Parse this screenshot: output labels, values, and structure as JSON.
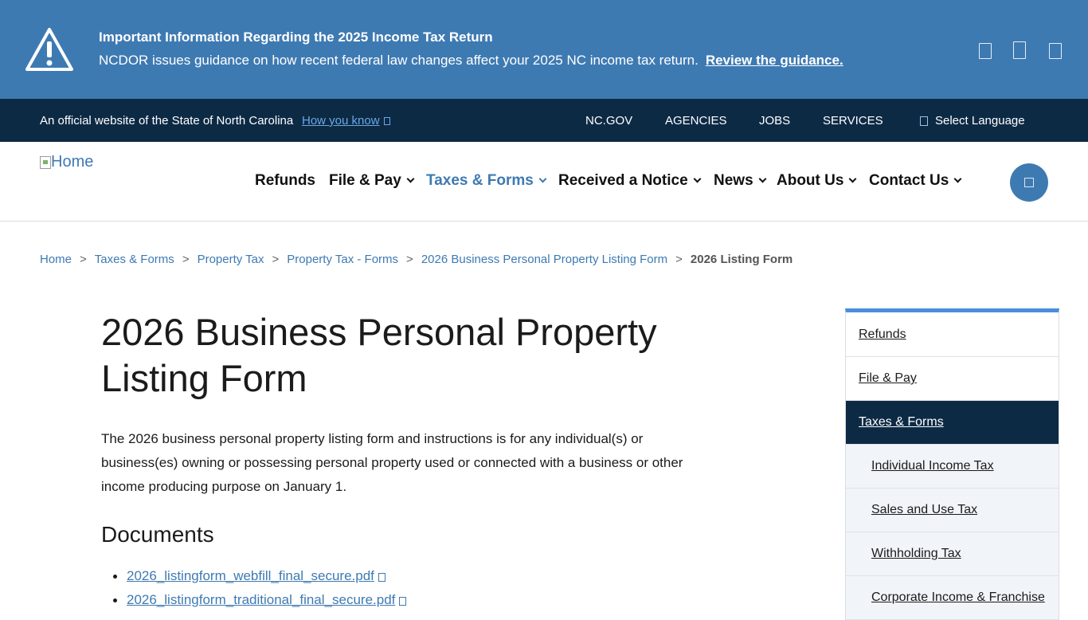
{
  "alert": {
    "title": "Important Information Regarding the 2025 Income Tax Return",
    "body": "NCDOR issues guidance on how recent federal law changes affect your 2025 NC income tax return.",
    "link": "Review the guidance."
  },
  "official_bar": {
    "text": "An official website of the State of North Carolina",
    "how_you_know": "How you know",
    "links": [
      "NC.GOV",
      "AGENCIES",
      "JOBS",
      "SERVICES"
    ],
    "language": "Select Language"
  },
  "header": {
    "logo_alt": "Home",
    "nav": [
      "Refunds",
      "File & Pay",
      "Taxes & Forms",
      "Received a Notice",
      "News",
      "About Us",
      "Contact Us"
    ]
  },
  "breadcrumb": {
    "items": [
      "Home",
      "Taxes & Forms",
      "Property Tax",
      "Property Tax - Forms",
      "2026 Business Personal Property Listing Form"
    ],
    "current": "2026 Listing Form"
  },
  "main": {
    "title": "2026 Business Personal Property Listing Form",
    "intro": "The 2026 business personal property listing form and instructions is for any individual(s) or business(es) owning or possessing personal property used or connected with a business or other income producing purpose on January 1.",
    "documents_heading": "Documents",
    "documents": [
      "2026_listingform_webfill_final_secure.pdf",
      "2026_listingform_traditional_final_secure.pdf"
    ]
  },
  "sidenav": {
    "items": [
      "Refunds",
      "File & Pay",
      "Taxes & Forms"
    ],
    "subitems": [
      "Individual Income Tax",
      "Sales and Use Tax",
      "Withholding Tax",
      "Corporate Income & Franchise"
    ]
  },
  "colors": {
    "alert_bg": "#3e7ab2",
    "official_bar_bg": "#0d2a45",
    "link": "#3e7ab2",
    "sidenav_accent": "#4a8ddc"
  }
}
